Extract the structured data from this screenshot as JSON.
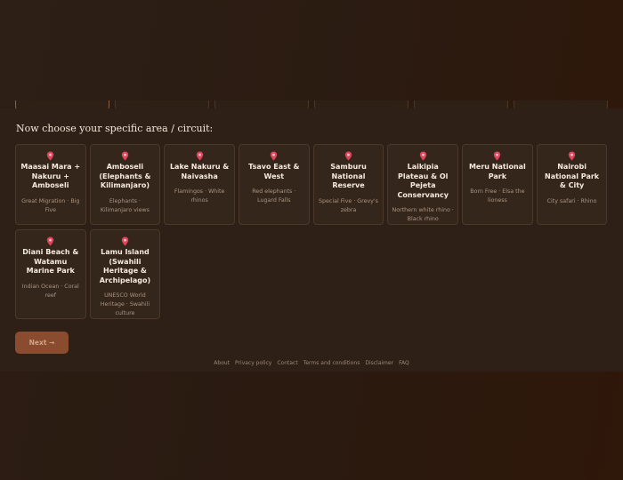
{
  "section": {
    "title": "Now choose your specific area / circuit:"
  },
  "cards": [
    {
      "name": "Maasai Mara + Nakuru + Amboseli",
      "desc": "Great Migration · Big Five",
      "icon": "map-pin-icon"
    },
    {
      "name": "Amboseli (Elephants & Kilimanjaro)",
      "desc": "Elephants · Kilimanjaro views",
      "icon": "map-pin-icon"
    },
    {
      "name": "Lake Nakuru & Naivasha",
      "desc": "Flamingos · White rhinos",
      "icon": "map-pin-icon"
    },
    {
      "name": "Tsavo East & West",
      "desc": "Red elephants · Lugard Falls",
      "icon": "map-pin-icon"
    },
    {
      "name": "Samburu National Reserve",
      "desc": "Special Five · Grevy's zebra",
      "icon": "map-pin-icon"
    },
    {
      "name": "Laikipia Plateau & Ol Pejeta Conservancy",
      "desc": "Northern white rhino · Black rhino",
      "icon": "map-pin-icon"
    },
    {
      "name": "Meru National Park",
      "desc": "Born Free · Elsa the lioness",
      "icon": "map-pin-icon"
    },
    {
      "name": "Nairobi National Park & City",
      "desc": "City safari · Rhino",
      "icon": "map-pin-icon"
    },
    {
      "name": "Diani Beach & Watamu Marine Park",
      "desc": "Indian Ocean · Coral reef",
      "icon": "map-pin-icon"
    },
    {
      "name": "Lamu Island (Swahili Heritage & Archipelago)",
      "desc": "UNESCO World Heritage · Swahili culture",
      "icon": "map-pin-icon"
    }
  ],
  "next_button": {
    "label": "Next →"
  },
  "footer": {
    "links": [
      "About",
      "Privacy policy",
      "Contact",
      "Terms and conditions",
      "Disclaimer",
      "FAQ"
    ]
  },
  "colors": {
    "accent": "#8a4c2f",
    "pin": "#e0435c",
    "card_bg": "#35261b"
  }
}
